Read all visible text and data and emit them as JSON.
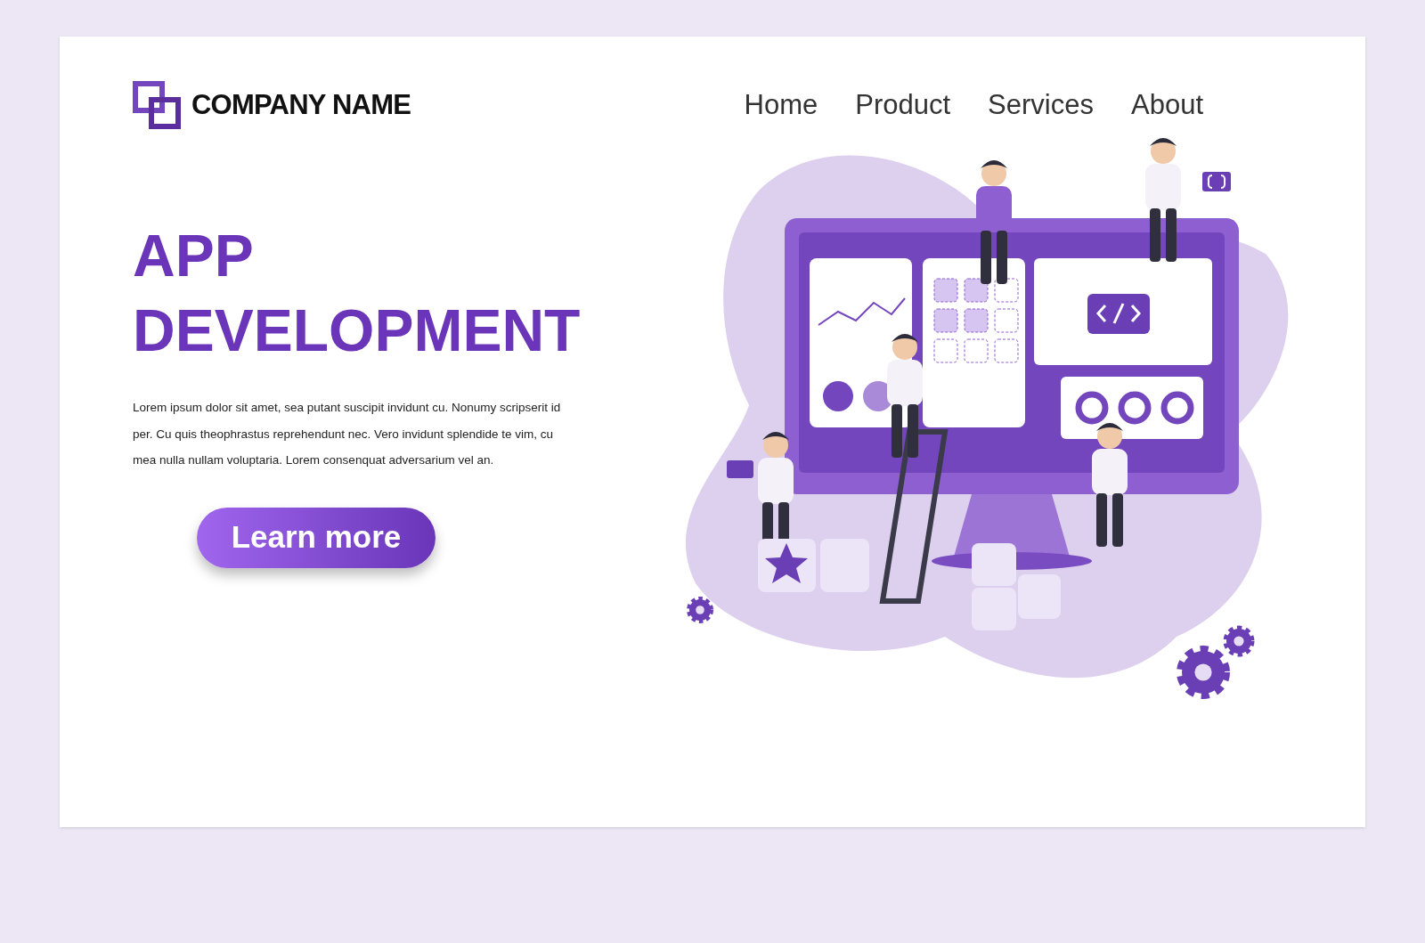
{
  "header": {
    "company_name": "COMPANY NAME",
    "nav": [
      "Home",
      "Product",
      "Services",
      "About"
    ]
  },
  "hero": {
    "title_lines": [
      "APP",
      "DEVELOPMENT"
    ],
    "paragraph": "Lorem ipsum dolor sit amet, sea putant suscipit invidunt cu. Nonumy scripserit id per. Cu quis theophrastus reprehendunt nec. Vero invidunt splendide te vim, cu mea nulla nullam voluptaria. Lorem consenquat adversarium vel an.",
    "button": "Learn more"
  }
}
